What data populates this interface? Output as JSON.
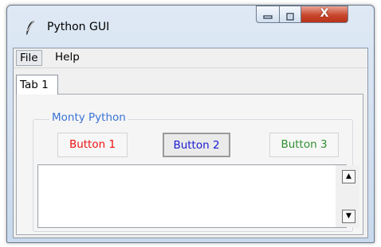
{
  "window": {
    "title": "Python GUI",
    "minimize_glyph": "▭",
    "maximize_glyph": "▢",
    "close_glyph": "X"
  },
  "menu": {
    "items": [
      {
        "label": "File"
      },
      {
        "label": "Help"
      }
    ]
  },
  "tabs": [
    {
      "label": "Tab 1"
    }
  ],
  "group": {
    "label": "Monty Python"
  },
  "buttons": [
    {
      "label": "Button 1",
      "color": "#ee1111"
    },
    {
      "label": "Button 2",
      "color": "#1a1ad2"
    },
    {
      "label": "Button 3",
      "color": "#2f8f2f"
    }
  ],
  "scrollbar": {
    "up_glyph": "▲",
    "down_glyph": "▼"
  },
  "text_area": {
    "value": ""
  },
  "colors": {
    "group_label": "#3a72d6",
    "close_button": "#c8482f"
  },
  "icons": {
    "app": "feather-icon"
  }
}
